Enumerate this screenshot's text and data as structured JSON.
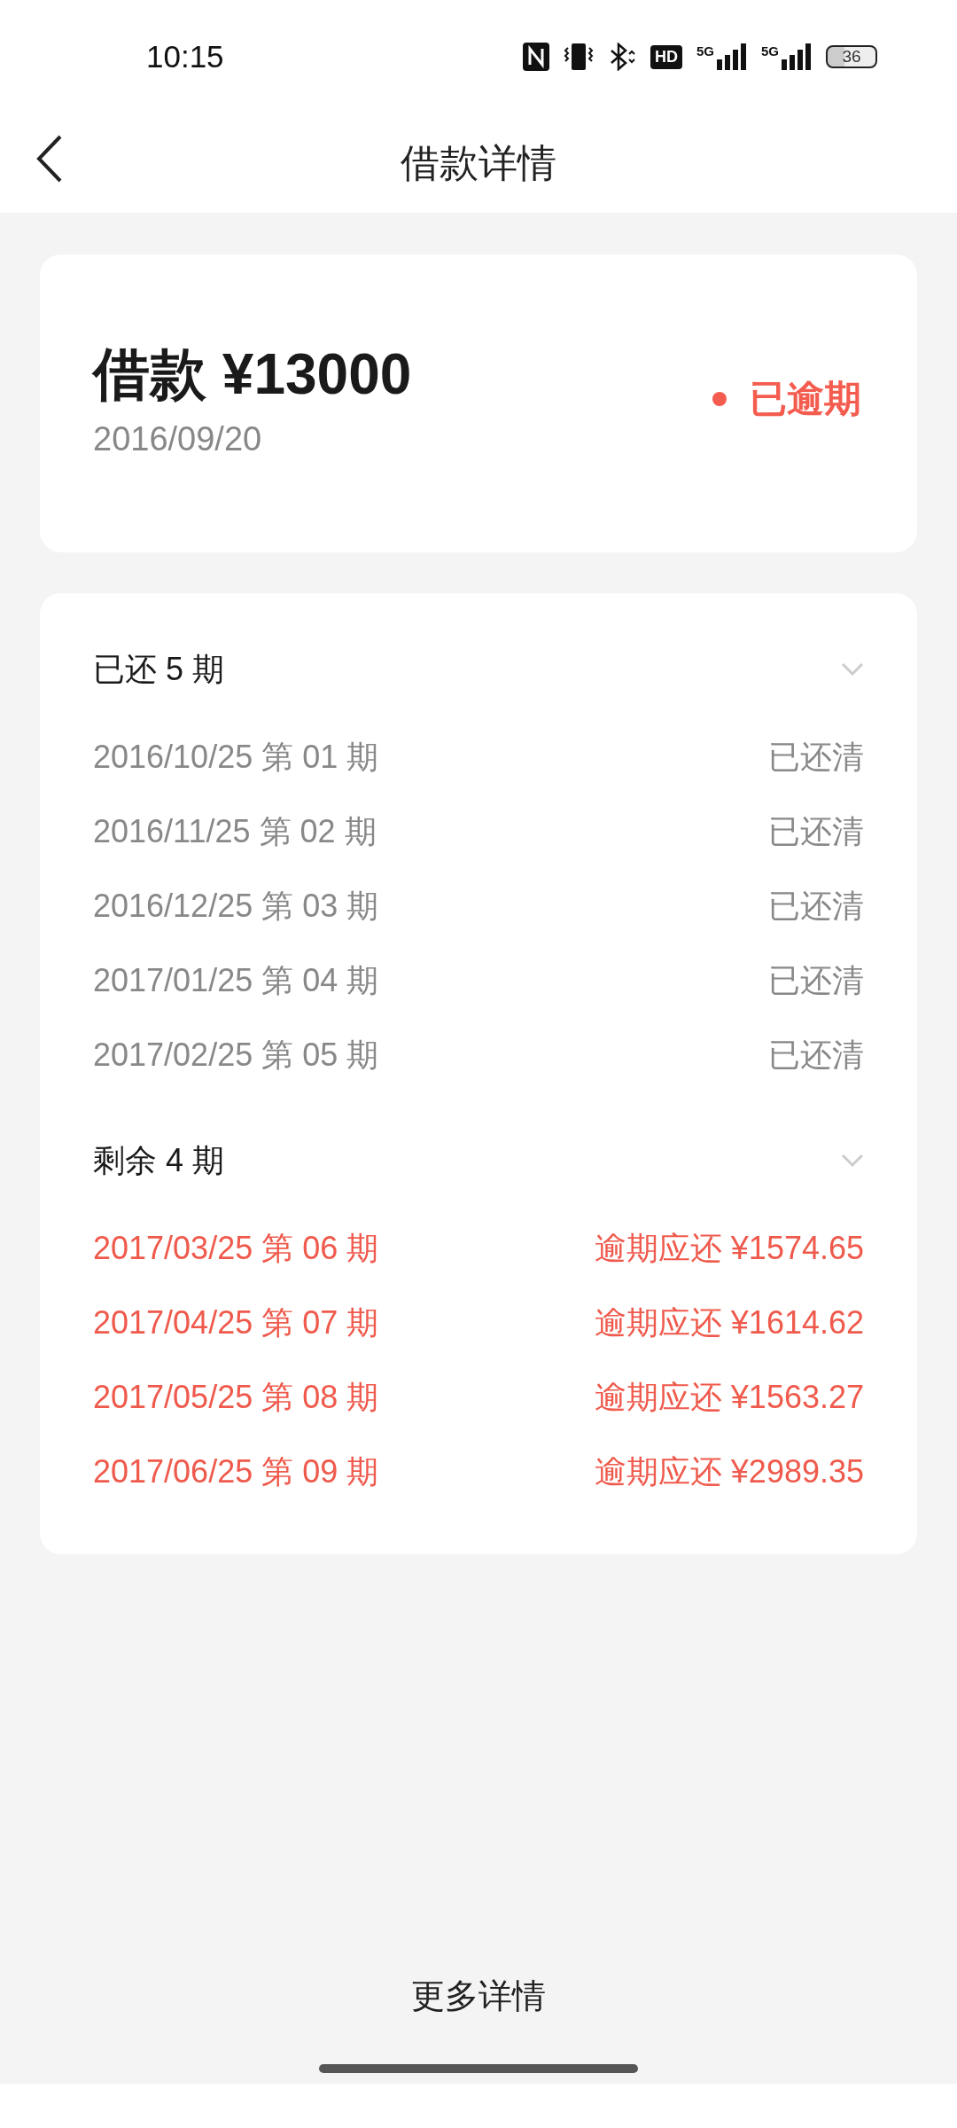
{
  "status_bar": {
    "time": "10:15",
    "hd_label": "HD",
    "network_labels": [
      "5G",
      "5G"
    ],
    "battery": "36"
  },
  "nav": {
    "title": "借款详情"
  },
  "loan": {
    "title": "借款 ¥13000",
    "date": "2016/09/20",
    "status": "已逾期",
    "color": "#f45c4f"
  },
  "groups": [
    {
      "title": "已还 5 期",
      "expanded": true,
      "rows": [
        {
          "kind": "paid",
          "label": "2016/10/25 第 01 期",
          "value": "已还清"
        },
        {
          "kind": "paid",
          "label": "2016/11/25 第 02 期",
          "value": "已还清"
        },
        {
          "kind": "paid",
          "label": "2016/12/25 第 03 期",
          "value": "已还清"
        },
        {
          "kind": "paid",
          "label": "2017/01/25 第 04 期",
          "value": "已还清"
        },
        {
          "kind": "paid",
          "label": "2017/02/25 第 05 期",
          "value": "已还清"
        }
      ]
    },
    {
      "title": "剩余 4 期",
      "expanded": true,
      "rows": [
        {
          "kind": "overdue",
          "label": "2017/03/25 第 06 期",
          "value": "逾期应还 ¥1574.65"
        },
        {
          "kind": "overdue",
          "label": "2017/04/25 第 07 期",
          "value": "逾期应还 ¥1614.62"
        },
        {
          "kind": "overdue",
          "label": "2017/05/25 第 08 期",
          "value": "逾期应还 ¥1563.27"
        },
        {
          "kind": "overdue",
          "label": "2017/06/25 第 09 期",
          "value": "逾期应还 ¥2989.35"
        }
      ]
    }
  ],
  "more_link": "更多详情"
}
